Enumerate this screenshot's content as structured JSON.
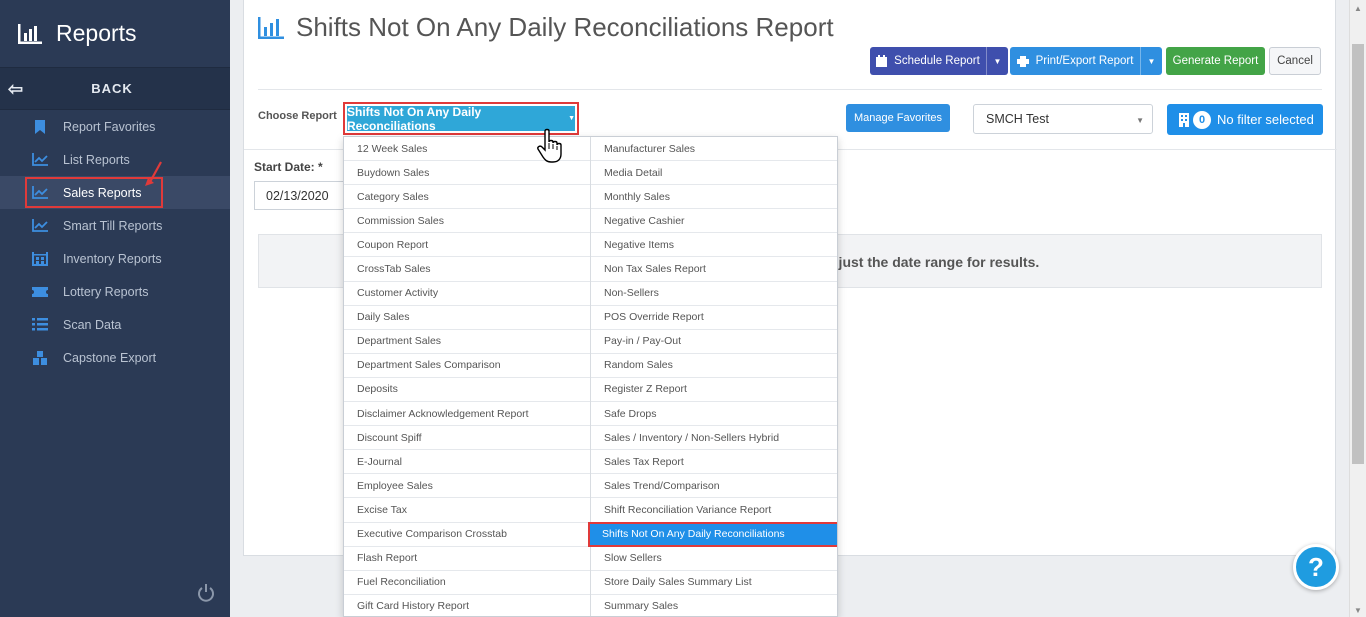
{
  "sidebar": {
    "title": "Reports",
    "back_label": "BACK",
    "items": [
      {
        "label": "Report Favorites",
        "icon": "bookmark-icon"
      },
      {
        "label": "List Reports",
        "icon": "chart-line-icon"
      },
      {
        "label": "Sales Reports",
        "icon": "chart-line-icon",
        "active": true
      },
      {
        "label": "Smart Till Reports",
        "icon": "chart-line-icon"
      },
      {
        "label": "Inventory Reports",
        "icon": "warehouse-icon"
      },
      {
        "label": "Lottery Reports",
        "icon": "ticket-icon"
      },
      {
        "label": "Scan Data",
        "icon": "list-icon"
      },
      {
        "label": "Capstone Export",
        "icon": "boxes-icon"
      }
    ]
  },
  "page": {
    "title": "Shifts Not On Any Daily Reconciliations Report"
  },
  "toolbar": {
    "schedule_label": "Schedule Report",
    "print_label": "Print/Export Report",
    "generate_label": "Generate Report",
    "cancel_label": "Cancel"
  },
  "filters": {
    "choose_report_label": "Choose Report",
    "selected_report": "Shifts Not On Any Daily Reconciliations",
    "manage_favorites_label": "Manage Favorites",
    "store_value": "SMCH Test",
    "filter_count": "0",
    "filter_label": "No filter selected",
    "start_date_label": "Start Date: *",
    "start_date_value": "02/13/2020"
  },
  "message": {
    "text": "djust the date range for results."
  },
  "dropdown": {
    "col1": [
      "12 Week Sales",
      "Buydown Sales",
      "Category Sales",
      "Commission Sales",
      "Coupon Report",
      "CrossTab Sales",
      "Customer Activity",
      "Daily Sales",
      "Department Sales",
      "Department Sales Comparison",
      "Deposits",
      "Disclaimer Acknowledgement Report",
      "Discount Spiff",
      "E-Journal",
      "Employee Sales",
      "Excise Tax",
      "Executive Comparison Crosstab",
      "Flash Report",
      "Fuel Reconciliation",
      "Gift Card History Report"
    ],
    "col2": [
      "Manufacturer Sales",
      "Media Detail",
      "Monthly Sales",
      "Negative Cashier",
      "Negative Items",
      "Non Tax Sales Report",
      "Non-Sellers",
      "POS Override Report",
      "Pay-in / Pay-Out",
      "Random Sales",
      "Register Z Report",
      "Safe Drops",
      "Sales / Inventory / Non-Sellers Hybrid",
      "Sales Tax Report",
      "Sales Trend/Comparison",
      "Shift Reconciliation Variance Report",
      "Shifts Not On Any Daily Reconciliations",
      "Slow Sellers",
      "Store Daily Sales Summary List",
      "Summary Sales"
    ],
    "selected": "Shifts Not On Any Daily Reconciliations"
  },
  "help": {
    "label": "?"
  },
  "colors": {
    "sidebar_bg": "#2b3a55",
    "accent_blue": "#1f8fe8",
    "schedule_btn": "#3f4fad",
    "generate_btn": "#43a447",
    "highlight_red": "#e03a3a"
  }
}
